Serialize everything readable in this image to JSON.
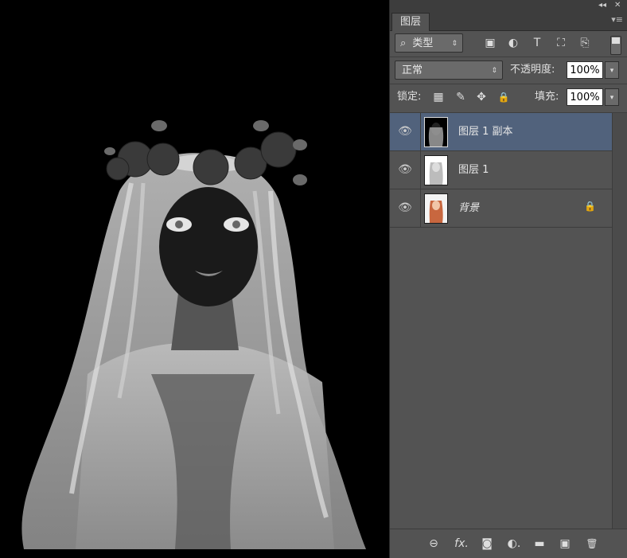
{
  "window": {
    "collapse": "◂◂",
    "close": "✕"
  },
  "panel": {
    "tab_label": "图层",
    "menu_glyph": "▾≡"
  },
  "filter": {
    "kind_label": "类型",
    "search_glyph": "⌕",
    "arrow": "⇕"
  },
  "blend": {
    "mode": "正常",
    "arrow": "⇕",
    "opacity_label": "不透明度:",
    "opacity_value": "100%",
    "dropdown": "▾"
  },
  "lockrow": {
    "label": "锁定:",
    "fill_label": "填充:",
    "fill_value": "100%",
    "dropdown": "▾"
  },
  "layers": [
    {
      "name": "图层 1 副本",
      "selected": true,
      "locked": false
    },
    {
      "name": "图层 1",
      "selected": false,
      "locked": false
    },
    {
      "name": "背景",
      "selected": false,
      "locked": true
    }
  ],
  "icons": {
    "eye": "👁",
    "lock": "🔒",
    "link": "⊖",
    "fx": "fx.",
    "mask": "◙",
    "adjust": "◐.",
    "folder": "▬",
    "new": "▣",
    "trash": "🗑",
    "pixel_filter": "▣",
    "adjust_filter": "◐",
    "type_filter": "T",
    "shape_filter": "⛶",
    "smart_filter": "⎘",
    "lock_transparent": "▦",
    "lock_brush": "✎",
    "lock_move": "✥",
    "lock_all": "🔒"
  },
  "colors": {
    "panel_bg": "#535353",
    "selected": "#51627c",
    "canvas": "#000000"
  }
}
